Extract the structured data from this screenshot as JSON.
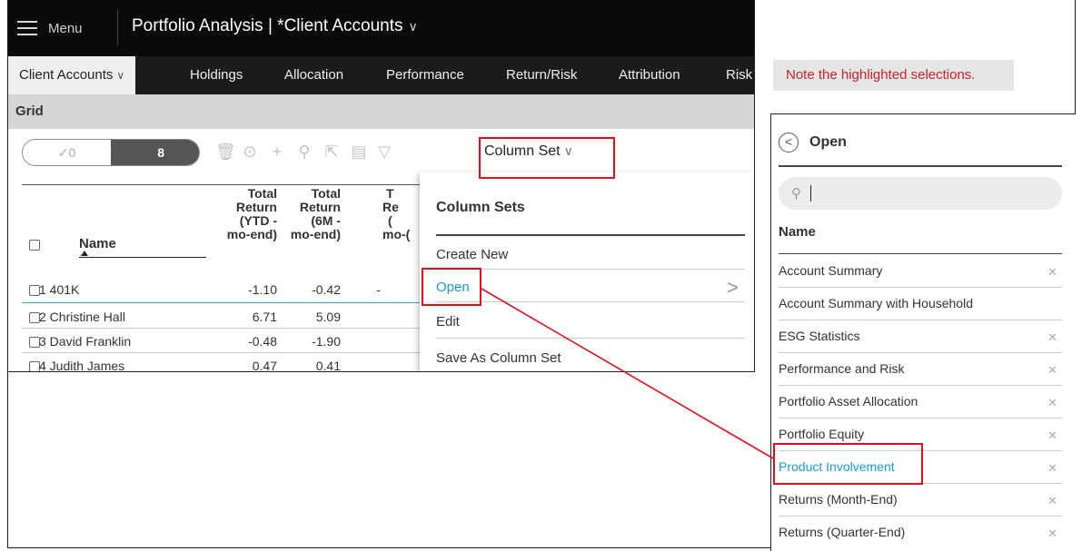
{
  "header": {
    "menu_label": "Menu",
    "title": "Portfolio Analysis | *Client Accounts",
    "title_chevron": "∨"
  },
  "tabs": [
    {
      "label": "Client Accounts",
      "active": true
    },
    {
      "label": "Holdings"
    },
    {
      "label": "Allocation"
    },
    {
      "label": "Performance"
    },
    {
      "label": "Return/Risk"
    },
    {
      "label": "Attribution"
    },
    {
      "label": "Risk"
    }
  ],
  "grid": {
    "section_label": "Grid",
    "toggle_left": "✓0",
    "toggle_right": "8",
    "column_set_label": "Column Set",
    "columns": {
      "name": "Name",
      "col1": [
        "Total",
        "Return",
        "(YTD -",
        "mo-end)"
      ],
      "col2": [
        "Total",
        "Return",
        "(6M -",
        "mo-end)"
      ],
      "col3": [
        "T",
        "Re",
        "(",
        "mo-("
      ]
    },
    "rows": [
      {
        "name": "1 401K",
        "v1": "-1.10",
        "v2": "-0.42",
        "v3": "-"
      },
      {
        "name": "2 Christine Hall",
        "v1": "6.71",
        "v2": "5.09",
        "v3": ""
      },
      {
        "name": "3 David Franklin",
        "v1": "-0.48",
        "v2": "-1.90",
        "v3": ""
      },
      {
        "name": "4 Judith James",
        "v1": "0.47",
        "v2": "0.41",
        "v3": ""
      }
    ]
  },
  "column_sets_menu": {
    "title": "Column Sets",
    "items": [
      "Create New",
      "Open",
      "Edit",
      "Save As Column Set"
    ]
  },
  "note": "Note the highlighted selections.",
  "open_panel": {
    "title": "Open",
    "search_placeholder": "",
    "name_header": "Name",
    "items": [
      {
        "label": "Account Summary",
        "icon": true
      },
      {
        "label": "Account Summary with Household",
        "icon": false
      },
      {
        "label": "ESG Statistics",
        "icon": true
      },
      {
        "label": "Performance and Risk",
        "icon": true
      },
      {
        "label": "Portfolio Asset Allocation",
        "icon": true
      },
      {
        "label": "Portfolio Equity",
        "icon": true
      },
      {
        "label": "Product Involvement",
        "icon": true,
        "selected": true
      },
      {
        "label": "Returns (Month-End)",
        "icon": true
      },
      {
        "label": "Returns (Quarter-End)",
        "icon": true
      }
    ]
  },
  "colors": {
    "highlight": "#e01020",
    "accent_blue": "#1a9ad6",
    "topbar": "#0a0a0a"
  }
}
